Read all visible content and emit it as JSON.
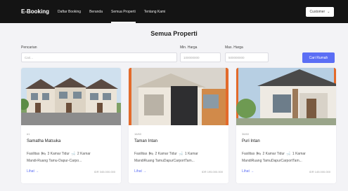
{
  "nav": {
    "brand": "E-Booking",
    "links": [
      "Daftar Booking",
      "Beranda",
      "Semua Properti",
      "Tentang Kami"
    ],
    "customer_label": "Customer",
    "caret": "⌄"
  },
  "page": {
    "title": "Semua Properti"
  },
  "search": {
    "keyword_label": "Pencarian",
    "keyword_placeholder": "Cari...",
    "min_label": "Min. Harga",
    "min_value": "100000000",
    "max_label": "Max. Harga",
    "max_value": "500000000",
    "button_label": "Cari Rumah"
  },
  "cards": [
    {
      "meta": "#1",
      "title": "Samatha Matsuka",
      "facility_prefix": "Fasilitas",
      "bedrooms": "3 Kamar Tidur",
      "bathrooms": "2 Kamar",
      "line2": "Mandi-Ruang Tamu-Dapur-Carpo...",
      "link": "Lihat →",
      "price": "IDR 345.000.000"
    },
    {
      "meta": "16/60",
      "title": "Taman Intan",
      "facility_prefix": "Fasilitas",
      "bedrooms": "2 Kamar Tidur",
      "bathrooms": "1 Kamar",
      "line2": "MandiRuang TamuDapurCarportTam...",
      "link": "Lihat →",
      "price": "IDR 195.000.000"
    },
    {
      "meta": "36/60",
      "title": "Puri Intan",
      "facility_prefix": "Fasilitas",
      "bedrooms": "2 Kamar Tidur",
      "bathrooms": "1 Kamar",
      "line2": "MandiRuang TamuDapurCarportTam...",
      "link": "Lihat →",
      "price": "IDR 145.000.000"
    }
  ],
  "icons": {
    "bed": "bed-icon",
    "bath": "bath-icon"
  },
  "colors": {
    "navbar": "#141414",
    "accent": "#5b6ef5",
    "background": "#f3f3f6"
  }
}
